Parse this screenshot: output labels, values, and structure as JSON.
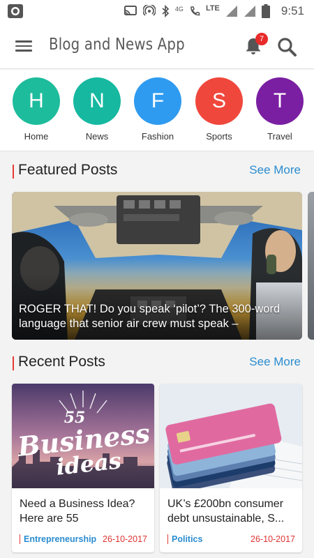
{
  "status_bar": {
    "time": "9:51",
    "network": "4G",
    "lte": "LTE"
  },
  "app_bar": {
    "title": "Blog and News App",
    "notification_count": "7"
  },
  "categories": [
    {
      "letter": "H",
      "label": "Home",
      "color": "#1dbc9c"
    },
    {
      "letter": "N",
      "label": "News",
      "color": "#16b8a0"
    },
    {
      "letter": "F",
      "label": "Fashion",
      "color": "#2f9bf0"
    },
    {
      "letter": "S",
      "label": "Sports",
      "color": "#f0473c"
    },
    {
      "letter": "T",
      "label": "Travel",
      "color": "#7b1fa2"
    }
  ],
  "featured": {
    "title": "Featured Posts",
    "see_more": "See More",
    "post": {
      "caption": "ROGER THAT! Do you speak ‘pilot’? The 300-word language that senior air crew must speak –"
    }
  },
  "recent": {
    "title": "Recent Posts",
    "see_more": "See More",
    "posts": [
      {
        "title": "Need a Business Idea? Here are 55",
        "category": "Entrepreneurship",
        "date": "26-10-2017",
        "image_text_number": "55",
        "image_text_line1": "Business",
        "image_text_line2": "ideas"
      },
      {
        "title": "UK’s £200bn consumer debt unsustainable, S...",
        "category": "Politics",
        "date": "26-10-2017"
      }
    ]
  }
}
